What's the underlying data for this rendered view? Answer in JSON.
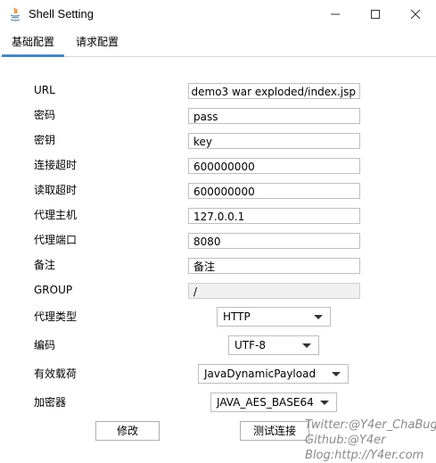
{
  "window": {
    "title": "Shell Setting",
    "icons": [
      "java-icon",
      "minimize-icon",
      "maximize-icon",
      "close-icon"
    ]
  },
  "tabs": [
    {
      "label": "基础配置",
      "active": true
    },
    {
      "label": "请求配置",
      "active": false
    }
  ],
  "fields": [
    {
      "label": "URL",
      "value": "demo3 war exploded/index.jsp"
    },
    {
      "label": "密码",
      "value": "pass"
    },
    {
      "label": "密钥",
      "value": "key"
    },
    {
      "label": "连接超时",
      "value": "600000000"
    },
    {
      "label": "读取超时",
      "value": "600000000"
    },
    {
      "label": "代理主机",
      "value": "127.0.0.1"
    },
    {
      "label": "代理端口",
      "value": "8080"
    },
    {
      "label": "备注",
      "value": "备注"
    },
    {
      "label": "GROUP",
      "value": "/"
    }
  ],
  "selects": [
    {
      "label": "代理类型",
      "value": "HTTP"
    },
    {
      "label": "编码",
      "value": "UTF-8"
    },
    {
      "label": "有效载荷",
      "value": "JavaDynamicPayload"
    },
    {
      "label": "加密器",
      "value": "JAVA_AES_BASE64"
    }
  ],
  "buttons": {
    "modify": "修改",
    "test": "测试连接"
  },
  "watermark": {
    "line1": "Twitter:@Y4er_ChaBug",
    "line2": "Github:@Y4er",
    "line3": "Blog:http://Y4er.com"
  },
  "colors": {
    "tab_accent": "#4a86c5",
    "java_icon_red": "#e76f00",
    "java_icon_blue": "#5382a1"
  }
}
